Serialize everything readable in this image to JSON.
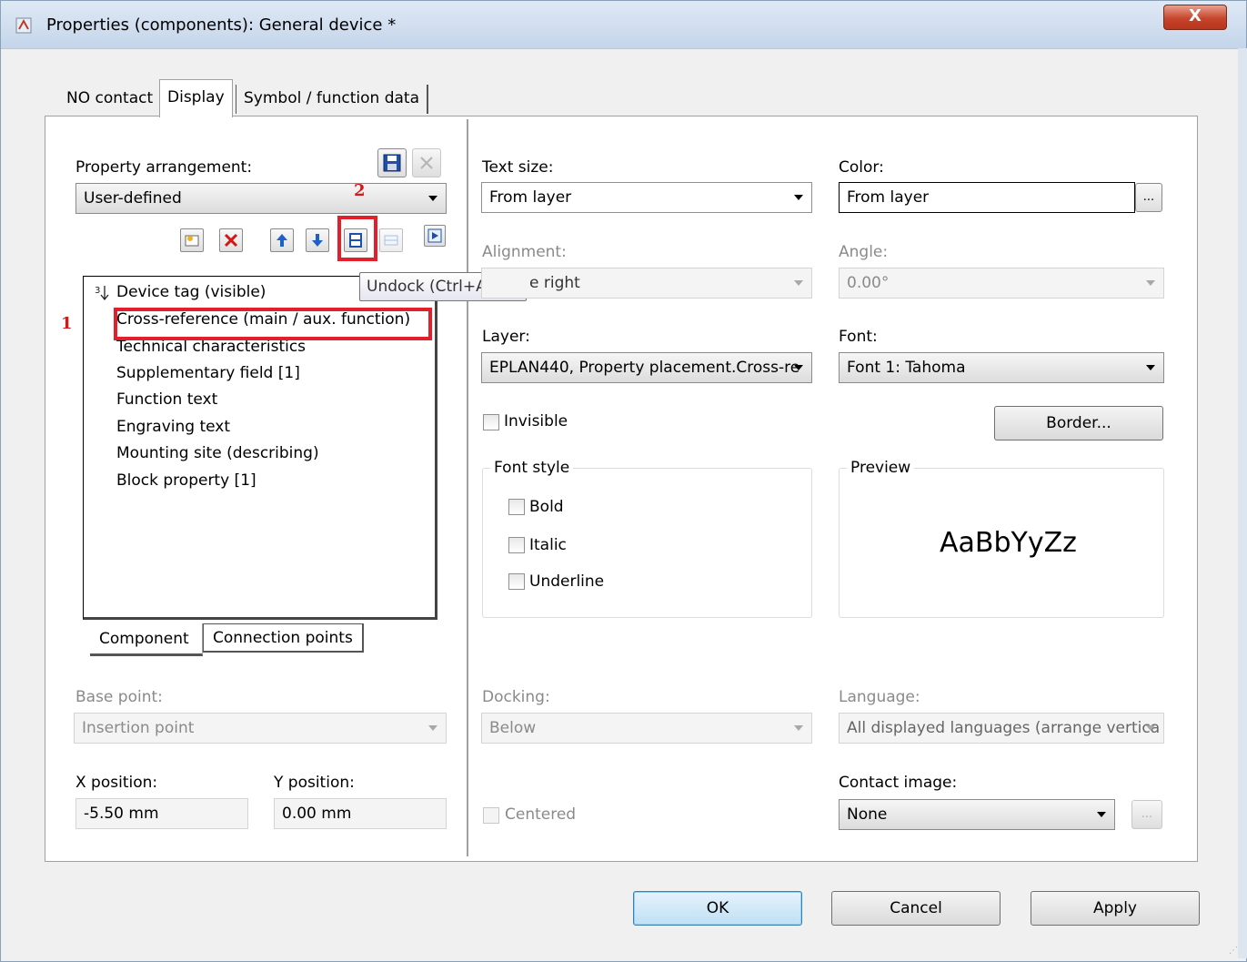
{
  "window": {
    "title": "Properties (components): General device *",
    "close_label": "X"
  },
  "tabs": [
    {
      "label": "NO contact"
    },
    {
      "label": "Display"
    },
    {
      "label": "Symbol / function data"
    }
  ],
  "left": {
    "property_arrangement_label": "Property arrangement:",
    "property_arrangement_value": "User-defined",
    "annotation_1": "1",
    "annotation_2": "2",
    "tooltip": "Undock (Ctrl+Alt+U)",
    "tree_items": [
      "Device tag (visible)",
      "Cross-reference (main / aux. function)",
      "Technical characteristics",
      "Supplementary field [1]",
      "Function text",
      "Engraving text",
      "Mounting site (describing)",
      "Block property [1]"
    ],
    "subtabs": [
      "Component",
      "Connection points"
    ],
    "base_point_label": "Base point:",
    "base_point_value": "Insertion point",
    "x_label": "X position:",
    "x_value": "-5.50 mm",
    "y_label": "Y position:",
    "y_value": "0.00 mm"
  },
  "right": {
    "text_size_label": "Text size:",
    "text_size_value": "From layer",
    "color_label": "Color:",
    "color_value": "From layer",
    "color_btn": "...",
    "alignment_label": "Alignment:",
    "alignment_value": "e right",
    "angle_label": "Angle:",
    "angle_value": "0.00°",
    "layer_label": "Layer:",
    "layer_value": "EPLAN440, Property placement.Cross-re",
    "font_label": "Font:",
    "font_value": "Font 1: Tahoma",
    "invisible_label": "Invisible",
    "border_btn": "Border...",
    "font_style_label": "Font style",
    "bold_label": "Bold",
    "italic_label": "Italic",
    "underline_label": "Underline",
    "preview_label": "Preview",
    "preview_text": "AaBbYyZz",
    "docking_label": "Docking:",
    "docking_value": "Below",
    "language_label": "Language:",
    "language_value": "All displayed languages (arrange vertica",
    "contact_image_label": "Contact image:",
    "contact_image_value": "None",
    "contact_image_btn": "...",
    "centered_label": "Centered"
  },
  "buttons": {
    "ok": "OK",
    "cancel": "Cancel",
    "apply": "Apply"
  }
}
